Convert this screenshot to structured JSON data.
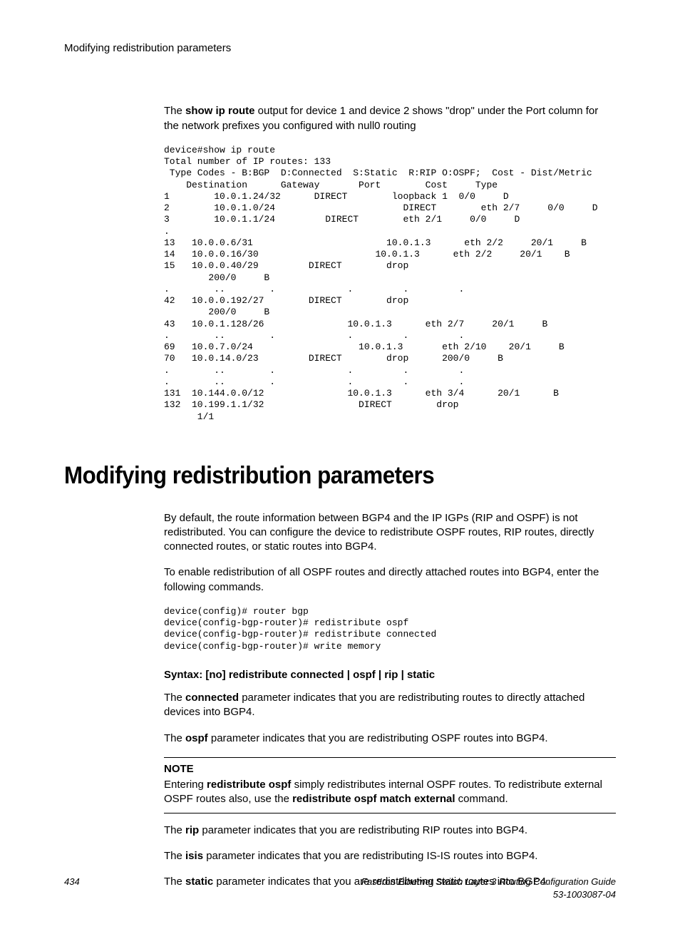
{
  "runningHeader": "Modifying redistribution parameters",
  "introPara": {
    "pre": "The ",
    "b1": "show ip route",
    "post": " output for device 1 and device 2 shows \"drop\" under the Port column for the network prefixes you configured with null0 routing"
  },
  "codeBlock1": "device#show ip route\nTotal number of IP routes: 133\n Type Codes - B:BGP  D:Connected  S:Static  R:RIP O:OSPF;  Cost - Dist/Metric\n    Destination      Gateway       Port        Cost     Type\n1        10.0.1.24/32      DIRECT        loopback 1  0/0     D\n2        10.0.1.0/24                       DIRECT        eth 2/7     0/0     D\n3        10.0.1.1/24         DIRECT        eth 2/1     0/0     D\n.\n13   10.0.0.6/31                        10.0.1.3      eth 2/2     20/1     B\n14   10.0.0.16/30                     10.0.1.3      eth 2/2     20/1    B\n15   10.0.0.40/29         DIRECT        drop        \n        200/0     B\n.        ..        .             .         .         .\n42   10.0.0.192/27        DIRECT        drop        \n        200/0     B\n43   10.0.1.128/26               10.0.1.3      eth 2/7     20/1     B      \n.        ..        .             .         .         .\n69   10.0.7.0/24                   10.0.1.3       eth 2/10    20/1     B\n70   10.0.14.0/23         DIRECT        drop      200/0     B\n.        ..        .             .         .         .\n.        ..        .             .         .         .\n131  10.144.0.0/12               10.0.1.3      eth 3/4      20/1      B\n132  10.199.1.1/32                 DIRECT        drop       \n      1/1",
  "sectionHeading": "Modifying redistribution parameters",
  "para1": "By default, the route information between BGP4 and the IP IGPs (RIP and OSPF) is not redistributed. You can configure the device to redistribute OSPF routes, RIP routes, directly connected routes, or static routes into BGP4.",
  "para2": "To enable redistribution of all OSPF routes and directly attached routes into BGP4, enter the following commands.",
  "codeBlock2": "device(config)# router bgp\ndevice(config-bgp-router)# redistribute ospf\ndevice(config-bgp-router)# redistribute connected\ndevice(config-bgp-router)# write memory",
  "syntaxLine": "Syntax: [no] redistribute connected | ospf | rip | static",
  "para3": {
    "pre": "The ",
    "b": "connected",
    "post": " parameter indicates that you are redistributing routes to directly attached devices into BGP4."
  },
  "para4": {
    "pre": "The ",
    "b": "ospf",
    "post": " parameter indicates that you are redistributing OSPF routes into BGP4."
  },
  "note": {
    "title": "NOTE",
    "pre": "Entering ",
    "b1": "redistribute ospf",
    "mid": " simply redistributes internal OSPF routes. To redistribute external OSPF routes also, use the ",
    "b2": "redistribute ospf match external",
    "post": " command."
  },
  "para5": {
    "pre": "The ",
    "b": "rip",
    "post": " parameter indicates that you are redistributing RIP routes into BGP4."
  },
  "para6": {
    "pre": "The ",
    "b": "isis",
    "post": " parameter indicates that you are redistributing IS-IS routes into BGP4."
  },
  "para7": {
    "pre": "The ",
    "b": "static",
    "post": " parameter indicates that you are redistributing static routes into BGP4."
  },
  "footer": {
    "pageNumber": "434",
    "title": "FastIron Ethernet Switch Layer 3 Routing Configuration Guide",
    "docNumber": "53-1003087-04"
  }
}
